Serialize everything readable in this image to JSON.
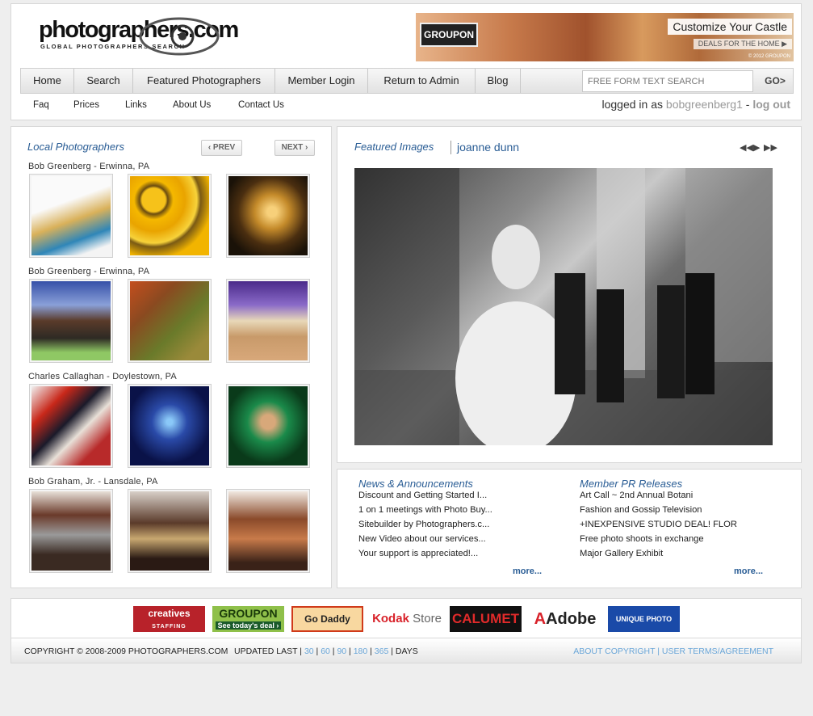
{
  "header": {
    "logo_text": "photographers.com",
    "logo_tagline": "GLOBAL PHOTOGRAPHERS SEARCH",
    "banner": {
      "brand": "GROUPON",
      "headline": "Customize Your Castle",
      "cta": "DEALS FOR THE HOME ▶",
      "copyright": "© 2012 GROUPON"
    }
  },
  "nav": {
    "items": [
      "Home",
      "Search",
      "Featured Photographers",
      "Member Login",
      "Return to Admin",
      "Blog"
    ],
    "search_placeholder": "FREE FORM TEXT SEARCH",
    "go_label": "GO>",
    "sub_items": [
      "Faq",
      "Prices",
      "Links",
      "About Us",
      "Contact Us"
    ],
    "login": {
      "prefix": "logged in as ",
      "username": "bobgreenberg1",
      "separator": " - ",
      "logout": "log out"
    }
  },
  "local": {
    "title": "Local Photographers",
    "prev_label": "‹ PREV",
    "next_label": "NEXT ›",
    "groups": [
      {
        "name": "Bob Greenberg - Erwinna, PA"
      },
      {
        "name": "Bob Greenberg - Erwinna, PA"
      },
      {
        "name": "Charles Callaghan - Doylestown, PA"
      },
      {
        "name": "Bob Graham, Jr. - Lansdale, PA"
      }
    ]
  },
  "featured": {
    "title": "Featured Images",
    "photographer": "joanne dunn",
    "controls": {
      "first": "◀◀",
      "play": "▶",
      "last": "▶▶"
    }
  },
  "news": {
    "title": "News & Announcements",
    "items": [
      "Discount and Getting Started I...",
      "1 on 1 meetings with Photo Buy...",
      "Sitebuilder by Photographers.c...",
      "New Video about our services...",
      "Your support is appreciated!..."
    ],
    "more_label": "more..."
  },
  "pr": {
    "title": "Member PR Releases",
    "items": [
      "Art Call ~ 2nd Annual Botani",
      "Fashion and Gossip Television",
      "+INEXPENSIVE STUDIO DEAL! FLOR",
      "Free photo shoots in exchange",
      "Major Gallery Exhibit"
    ],
    "more_label": "more..."
  },
  "sponsors": {
    "creatives": "creatives",
    "creatives_sub": "STAFFING",
    "groupon": "GROUPON",
    "groupon_sub": "See today's deal ›",
    "godaddy": "Go Daddy",
    "kodak": "Kodak",
    "kodak_store": "Store",
    "calumet": "CALUMET",
    "adobe": "Adobe",
    "unique": "UNIQUE PHOTO"
  },
  "footer": {
    "copyright": "COPYRIGHT © 2008-2009 PHOTOGRAPHERS.COM",
    "updated": "UPDATED LAST",
    "days": [
      "30",
      "60",
      "90",
      "180",
      "365"
    ],
    "days_label": "DAYS",
    "about_copyright": "ABOUT COPYRIGHT",
    "terms": "USER TERMS/AGREEMENT"
  },
  "colors": {
    "link_blue": "#2a5d95",
    "light_link": "#6aa6d8"
  }
}
